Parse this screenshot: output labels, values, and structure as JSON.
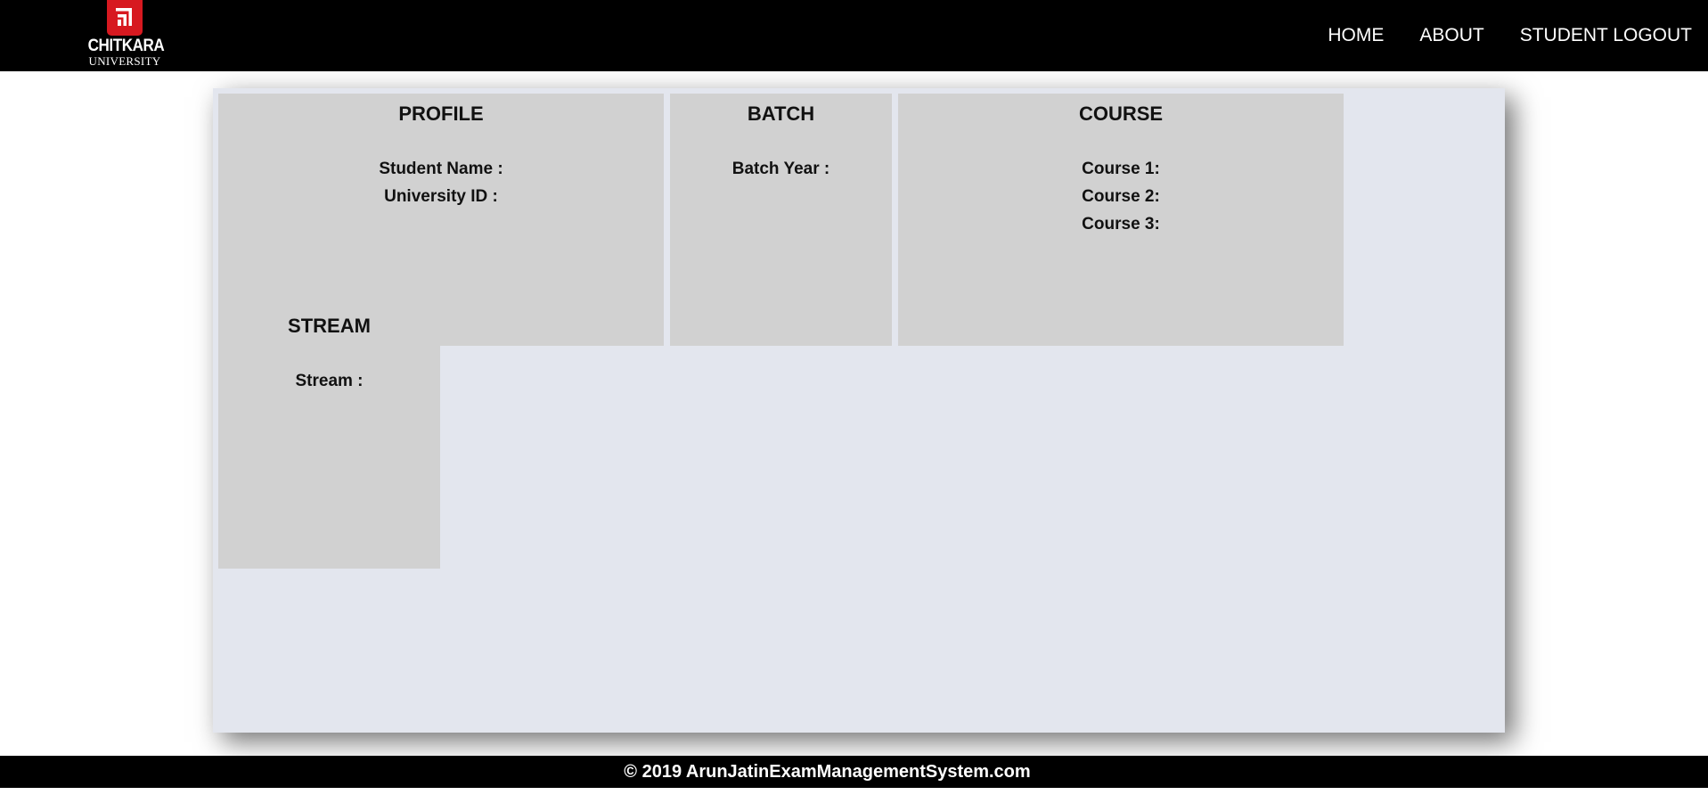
{
  "header": {
    "logo": {
      "name": "CHITKARA",
      "subtitle": "UNIVERSITY",
      "mark_color": "#d71920",
      "icon": "chitkara-logo-icon"
    },
    "nav": [
      {
        "label": "HOME"
      },
      {
        "label": "ABOUT"
      },
      {
        "label": "STUDENT LOGOUT"
      }
    ]
  },
  "cards": {
    "profile": {
      "title": "PROFILE",
      "fields": [
        "Student Name :",
        "University ID :"
      ]
    },
    "batch": {
      "title": "BATCH",
      "fields": [
        "Batch Year :"
      ]
    },
    "course": {
      "title": "COURSE",
      "fields": [
        "Course 1:",
        "Course 2:",
        "Course 3:"
      ]
    },
    "stream": {
      "title": "STREAM",
      "fields": [
        "Stream :"
      ]
    }
  },
  "footer": {
    "text": "© 2019 ArunJatinExamManagementSystem.com"
  },
  "colors": {
    "header_bg": "#000000",
    "panel_bg": "#e3e6ee",
    "card_bg": "#d1d1d1",
    "footer_bg": "#000000"
  }
}
